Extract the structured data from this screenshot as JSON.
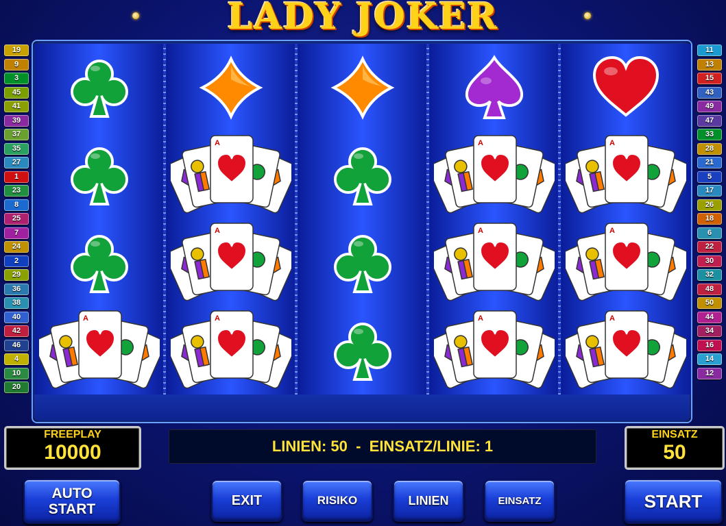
{
  "title": "LADY JOKER",
  "left_lines": [
    {
      "n": "19",
      "color": "#c8a000"
    },
    {
      "n": "9",
      "color": "#c08000"
    },
    {
      "n": "3",
      "color": "#00902a"
    },
    {
      "n": "45",
      "color": "#7aa000"
    },
    {
      "n": "41",
      "color": "#8aa000"
    },
    {
      "n": "39",
      "color": "#8a2aa0"
    },
    {
      "n": "37",
      "color": "#6aa030"
    },
    {
      "n": "35",
      "color": "#2aa060"
    },
    {
      "n": "27",
      "color": "#2a8ac0"
    },
    {
      "n": "1",
      "color": "#d01010"
    },
    {
      "n": "23",
      "color": "#209040"
    },
    {
      "n": "8",
      "color": "#1a6ad0"
    },
    {
      "n": "25",
      "color": "#b02070"
    },
    {
      "n": "7",
      "color": "#a020a0"
    },
    {
      "n": "24",
      "color": "#c09000"
    },
    {
      "n": "2",
      "color": "#1040c0"
    },
    {
      "n": "29",
      "color": "#8aa000"
    },
    {
      "n": "36",
      "color": "#2a7ab0"
    },
    {
      "n": "38",
      "color": "#2a90b0"
    },
    {
      "n": "40",
      "color": "#3060d0"
    },
    {
      "n": "42",
      "color": "#c02040"
    },
    {
      "n": "46",
      "color": "#204090"
    },
    {
      "n": "4",
      "color": "#c0b000"
    },
    {
      "n": "10",
      "color": "#2a8a40"
    },
    {
      "n": "20",
      "color": "#207a30"
    }
  ],
  "right_lines": [
    {
      "n": "11",
      "color": "#1a9ad0"
    },
    {
      "n": "13",
      "color": "#c08000"
    },
    {
      "n": "15",
      "color": "#d02020"
    },
    {
      "n": "43",
      "color": "#3060c0"
    },
    {
      "n": "49",
      "color": "#8a2aa0"
    },
    {
      "n": "47",
      "color": "#5a3aa0"
    },
    {
      "n": "33",
      "color": "#00902a"
    },
    {
      "n": "28",
      "color": "#c09000"
    },
    {
      "n": "21",
      "color": "#2a6ad0"
    },
    {
      "n": "5",
      "color": "#1a40c0"
    },
    {
      "n": "17",
      "color": "#2a8ac0"
    },
    {
      "n": "26",
      "color": "#9aa000"
    },
    {
      "n": "18",
      "color": "#d06000"
    },
    {
      "n": "6",
      "color": "#2a90b0"
    },
    {
      "n": "22",
      "color": "#c02040"
    },
    {
      "n": "30",
      "color": "#c02050"
    },
    {
      "n": "32",
      "color": "#1a90a0"
    },
    {
      "n": "48",
      "color": "#c02040"
    },
    {
      "n": "50",
      "color": "#c09000"
    },
    {
      "n": "44",
      "color": "#b02090"
    },
    {
      "n": "34",
      "color": "#a02060"
    },
    {
      "n": "16",
      "color": "#c01050"
    },
    {
      "n": "14",
      "color": "#2aa0d0"
    },
    {
      "n": "12",
      "color": "#8a2aa0"
    }
  ],
  "reels": [
    [
      "club",
      "club",
      "club",
      "cards"
    ],
    [
      "diamond",
      "cards",
      "cards",
      "cards"
    ],
    [
      "diamond",
      "club",
      "club",
      "club"
    ],
    [
      "spade",
      "cards",
      "cards",
      "cards"
    ],
    [
      "heart",
      "cards",
      "cards",
      "cards"
    ]
  ],
  "colors": {
    "club": "#12a23a",
    "diamond": "#ff8a00",
    "spade": "#a22ad0",
    "heart": "#e01020",
    "panel_text": "#ffe33a"
  },
  "freeplay": {
    "label": "FREEPLAY",
    "value": "10000"
  },
  "einsatz": {
    "label": "EINSATZ",
    "value": "50"
  },
  "info_text": "LINIEN: 50  -  EINSATZ/LINIE: 1",
  "buttons": {
    "auto_start_1": "AUTO",
    "auto_start_2": "START",
    "exit": "EXIT",
    "risiko": "RISIKO",
    "linien": "LINIEN",
    "einsatz": "EINSATZ",
    "start": "START"
  }
}
